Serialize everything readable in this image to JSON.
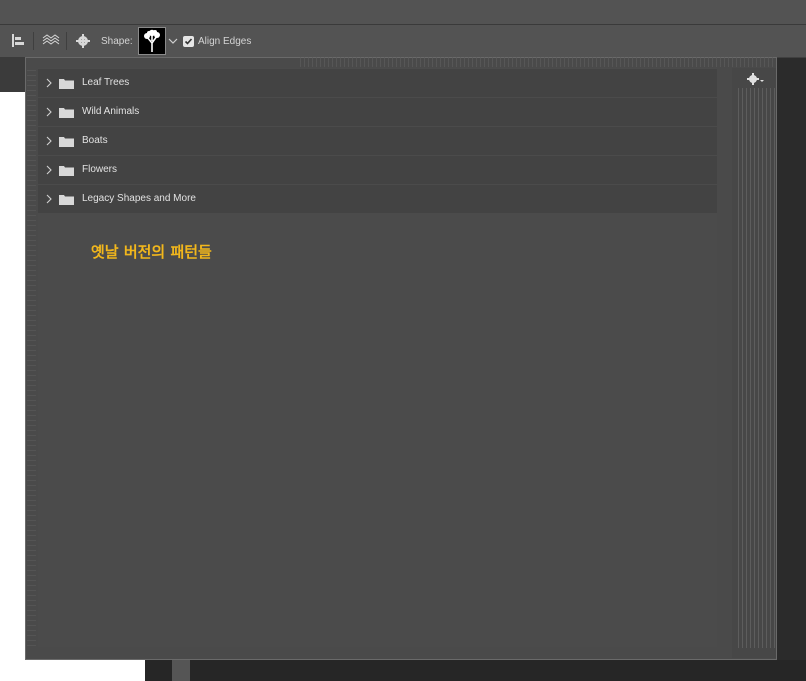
{
  "options_bar": {
    "shape_label": "Shape:",
    "align_edges_label": "Align Edges",
    "align_edges_checked": true
  },
  "shapes_panel": {
    "folders": [
      {
        "label": "Leaf Trees"
      },
      {
        "label": "Wild Animals"
      },
      {
        "label": "Boats"
      },
      {
        "label": "Flowers"
      },
      {
        "label": "Legacy Shapes and More"
      }
    ]
  },
  "annotation": {
    "text": "옛날 버전의 패턴들",
    "color": "#f2b71c"
  },
  "icons": [
    "align-left-icon",
    "path-arrange-icon",
    "gear-icon",
    "tree-shape-icon",
    "chevron-down-icon",
    "checkbox-icon",
    "chevron-right-icon",
    "folder-icon",
    "panel-gear-icon"
  ]
}
